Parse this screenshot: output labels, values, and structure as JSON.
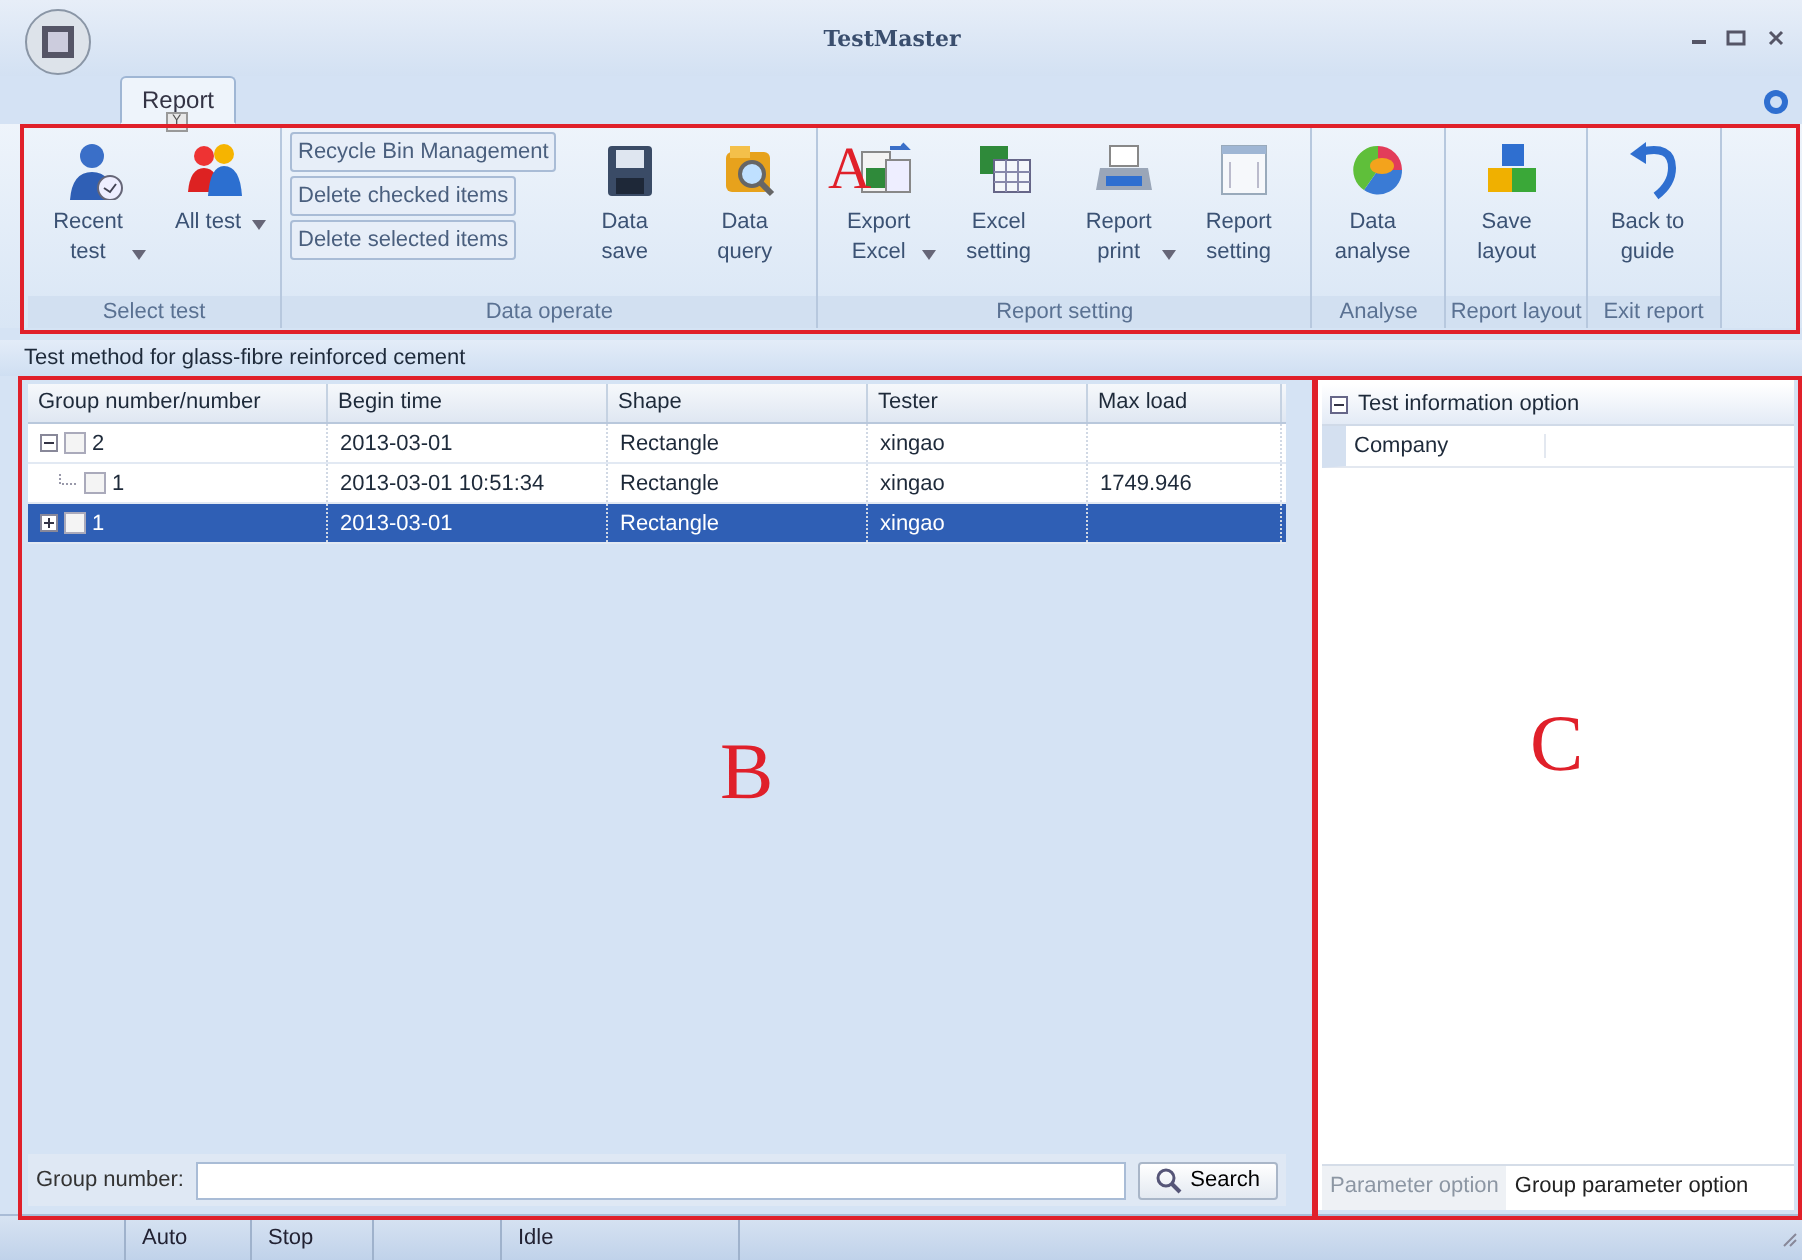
{
  "window": {
    "title": "TestMaster"
  },
  "ribbon": {
    "tabs": [
      {
        "label": "Report",
        "selected": true,
        "keytip": "Y"
      }
    ],
    "groups": [
      {
        "label": "Select test",
        "buttons": [
          {
            "label": "Recent test",
            "dropdown": true
          },
          {
            "label": "All test",
            "dropdown": true
          }
        ]
      },
      {
        "label": "Data operate",
        "small_buttons": [
          "Recycle Bin Management",
          "Delete checked items",
          "Delete selected items"
        ],
        "buttons": [
          {
            "label": "Data save",
            "dropdown": false
          },
          {
            "label": "Data query",
            "dropdown": false
          }
        ]
      },
      {
        "label": "Report setting",
        "buttons": [
          {
            "label": "Export Excel",
            "dropdown": true
          },
          {
            "label": "Excel setting",
            "dropdown": false
          },
          {
            "label": "Report print",
            "dropdown": true
          },
          {
            "label": "Report setting",
            "dropdown": false
          }
        ]
      },
      {
        "label": "Analyse",
        "buttons": [
          {
            "label": "Data analyse",
            "dropdown": false
          }
        ]
      },
      {
        "label": "Report layout",
        "buttons": [
          {
            "label": "Save layout",
            "dropdown": false
          }
        ]
      },
      {
        "label": "Exit report",
        "buttons": [
          {
            "label": "Back to guide",
            "dropdown": false
          }
        ]
      }
    ]
  },
  "method_bar": "Test method for glass-fibre reinforced cement",
  "table": {
    "columns": [
      "Group number/number",
      "Begin time",
      "Shape",
      "Tester",
      "Max load"
    ],
    "rows": [
      {
        "cells": [
          "2",
          "2013-03-01",
          "Rectangle",
          "xingao",
          ""
        ],
        "checked": false,
        "expanded": true,
        "selected": false,
        "children": [
          {
            "cells": [
              "1",
              "2013-03-01 10:51:34",
              "Rectangle",
              "xingao",
              "1749.946"
            ],
            "checked": false,
            "selected": false
          }
        ]
      },
      {
        "cells": [
          "1",
          "2013-03-01",
          "Rectangle",
          "xingao",
          ""
        ],
        "checked": false,
        "expanded": false,
        "selected": true
      }
    ]
  },
  "search": {
    "label": "Group number:",
    "button": "Search"
  },
  "property_grid": {
    "category": "Test information option",
    "expanded": true,
    "rows": [
      "Company"
    ]
  },
  "panel_tabs": [
    {
      "label": "Parameter option",
      "selected": false
    },
    {
      "label": "Group parameter option",
      "selected": true
    }
  ],
  "status_bar": [
    "Auto",
    "Stop",
    "Idle"
  ],
  "annotations": [
    "A",
    "B",
    "C"
  ]
}
